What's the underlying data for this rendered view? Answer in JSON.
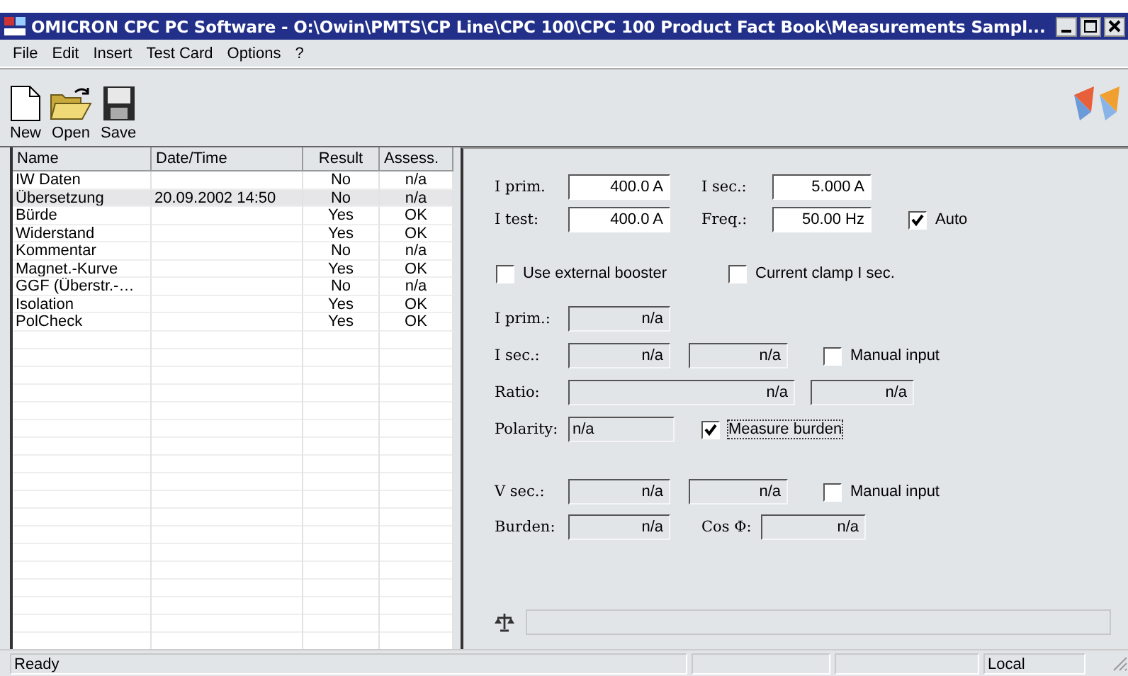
{
  "window": {
    "title": "OMICRON CPC PC Software - O:\\Owin\\PMTS\\CP Line\\CPC 100\\CPC 100 Product Fact Book\\Measurements Sampl..."
  },
  "menu": [
    "File",
    "Edit",
    "Insert",
    "Test Card",
    "Options",
    "?"
  ],
  "toolbar": [
    {
      "kind": "new",
      "label": "New"
    },
    {
      "kind": "open",
      "label": "Open"
    },
    {
      "kind": "save",
      "label": "Save"
    }
  ],
  "table": {
    "columns": [
      "Name",
      "Date/Time",
      "Result",
      "Assess."
    ],
    "rows": [
      {
        "name": "IW Daten",
        "datetime": "",
        "result": "No",
        "assess": "n/a",
        "selected": false
      },
      {
        "name": "Übersetzung",
        "datetime": "20.09.2002 14:50",
        "result": "No",
        "assess": "n/a",
        "selected": true
      },
      {
        "name": "Bürde",
        "datetime": "",
        "result": "Yes",
        "assess": "OK",
        "selected": false
      },
      {
        "name": "Widerstand",
        "datetime": "",
        "result": "Yes",
        "assess": "OK",
        "selected": false
      },
      {
        "name": "Kommentar",
        "datetime": "",
        "result": "No",
        "assess": "n/a",
        "selected": false
      },
      {
        "name": "Magnet.-Kurve",
        "datetime": "",
        "result": "Yes",
        "assess": "OK",
        "selected": false
      },
      {
        "name": "GGF (Überstr.-…",
        "datetime": "",
        "result": "No",
        "assess": "n/a",
        "selected": false
      },
      {
        "name": "Isolation",
        "datetime": "",
        "result": "Yes",
        "assess": "OK",
        "selected": false
      },
      {
        "name": "PolCheck",
        "datetime": "",
        "result": "Yes",
        "assess": "OK",
        "selected": false
      }
    ]
  },
  "form": {
    "rows": [
      {
        "items": [
          {
            "kind": "label",
            "text": "I prim."
          },
          {
            "kind": "field",
            "value": "400.0 A",
            "disabled": false
          },
          {
            "kind": "label",
            "text": "I sec.:"
          },
          {
            "kind": "field",
            "value": "5.000 A",
            "disabled": false
          }
        ]
      },
      {
        "items": [
          {
            "kind": "label",
            "text": "I test:"
          },
          {
            "kind": "field",
            "value": "400.0 A",
            "disabled": false
          },
          {
            "kind": "label",
            "text": "Freq.:"
          },
          {
            "kind": "field",
            "value": "50.00 Hz",
            "disabled": false
          },
          {
            "kind": "checkbox",
            "label": "Auto",
            "checked": true,
            "focused": false
          }
        ]
      },
      {
        "items": [
          {
            "kind": "checkbox",
            "label": "Use external booster",
            "checked": false,
            "focused": false
          },
          {
            "kind": "checkbox",
            "label": "Current clamp I sec.",
            "checked": false,
            "focused": false
          }
        ]
      },
      {
        "items": [
          {
            "kind": "label",
            "text": "I prim.:"
          },
          {
            "kind": "field",
            "value": "n/a",
            "disabled": true
          }
        ]
      },
      {
        "items": [
          {
            "kind": "label",
            "text": "I sec.:"
          },
          {
            "kind": "field",
            "value": "n/a",
            "disabled": true
          },
          {
            "kind": "field",
            "value": "n/a",
            "disabled": true
          },
          {
            "kind": "checkbox",
            "label": "Manual input",
            "checked": false,
            "focused": false
          }
        ]
      },
      {
        "items": [
          {
            "kind": "label",
            "text": "Ratio:"
          },
          {
            "kind": "field",
            "value": "n/a",
            "disabled": true
          },
          {
            "kind": "field",
            "value": "n/a",
            "disabled": true
          }
        ]
      },
      {
        "items": [
          {
            "kind": "label",
            "text": "Polarity:"
          },
          {
            "kind": "field",
            "value": "n/a",
            "disabled": true
          },
          {
            "kind": "checkbox",
            "label": "Measure burden",
            "checked": true,
            "focused": true
          }
        ]
      },
      {
        "items": [
          {
            "kind": "label",
            "text": "V sec.:"
          },
          {
            "kind": "field",
            "value": "n/a",
            "disabled": true
          },
          {
            "kind": "field",
            "value": "n/a",
            "disabled": true
          },
          {
            "kind": "checkbox",
            "label": "Manual input",
            "checked": false,
            "focused": false
          }
        ]
      },
      {
        "items": [
          {
            "kind": "label",
            "text": "Burden:"
          },
          {
            "kind": "field",
            "value": "n/a",
            "disabled": true
          },
          {
            "kind": "label",
            "text": "Cos Φ:"
          },
          {
            "kind": "field",
            "value": "n/a",
            "disabled": true
          }
        ]
      }
    ]
  },
  "progress": {
    "level": 0
  },
  "status_bar": {
    "message": "Ready",
    "mode": "Local"
  }
}
